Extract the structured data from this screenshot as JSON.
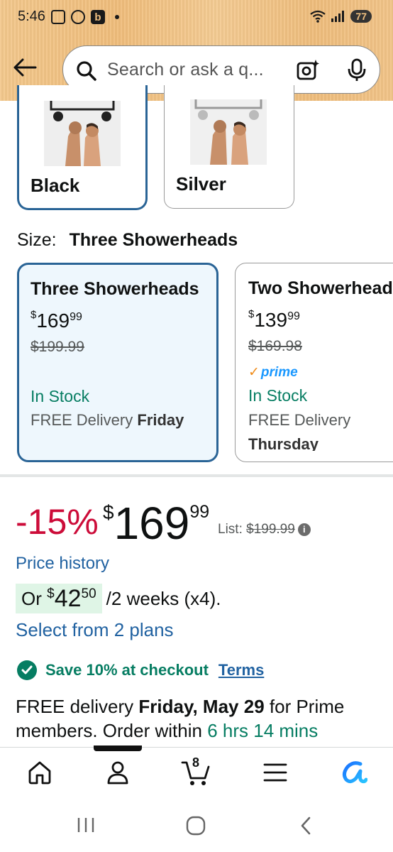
{
  "status_bar": {
    "time": "5:46",
    "network": "6E",
    "battery": "77"
  },
  "search": {
    "placeholder": "Search or ask a q..."
  },
  "colors": {
    "options": [
      {
        "label": "Black",
        "selected": true
      },
      {
        "label": "Silver",
        "selected": false
      }
    ]
  },
  "size": {
    "key_label": "Size:",
    "selected_value": "Three Showerheads",
    "options": [
      {
        "title": "Three Showerheads",
        "price_currency": "$",
        "price_whole": "169",
        "price_cents": "99",
        "list_price": "$199.99",
        "prime": false,
        "stock": "In Stock",
        "delivery_prefix": "FREE Delivery",
        "delivery_day": "Friday",
        "selected": true
      },
      {
        "title": "Two Showerheads",
        "price_currency": "$",
        "price_whole": "139",
        "price_cents": "99",
        "list_price": "$169.98",
        "prime": true,
        "prime_label": "prime",
        "stock": "In Stock",
        "delivery_prefix": "FREE Delivery",
        "delivery_day": "Thursday",
        "selected": false
      }
    ]
  },
  "price": {
    "discount": "-15%",
    "currency": "$",
    "whole": "169",
    "cents": "99",
    "list_label": "List:",
    "list_value": "$199.99"
  },
  "price_history_link": "Price history",
  "installment": {
    "prefix": "Or",
    "currency": "$",
    "whole": "42",
    "cents": "50",
    "suffix": "/2 weeks (x4)."
  },
  "select_plans_link": "Select from 2 plans",
  "promo": {
    "text": "Save 10% at checkout",
    "terms": "Terms"
  },
  "delivery": {
    "prefix": "FREE delivery",
    "date": "Friday, May 29",
    "middle": "for Prime members. Order within",
    "countdown": "6 hrs 14 mins"
  },
  "bottom_nav": {
    "items": [
      "home",
      "account",
      "cart",
      "menu",
      "rufus"
    ],
    "cart_count": "8"
  },
  "theme": {
    "accent_blue": "#2a6496",
    "link_blue": "#2162a1",
    "deal_red": "#cc0c39",
    "stock_green": "#067d62"
  }
}
